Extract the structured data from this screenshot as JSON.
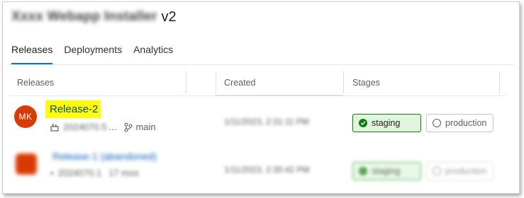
{
  "header": {
    "title_redacted": "Xxxx Webapp Installer",
    "title_version": "v2"
  },
  "tabs": [
    {
      "label": "Releases"
    },
    {
      "label": "Deployments"
    },
    {
      "label": "Analytics"
    }
  ],
  "table": {
    "columns": [
      "Releases",
      "Created",
      "Stages"
    ],
    "rows": [
      {
        "avatar_initials": "MK",
        "name": "Release-2",
        "build": "2024070.5",
        "branch": "main",
        "created": "1/11/2023, 2:31:11 PM",
        "stages": [
          {
            "label": "staging",
            "status": "succeeded"
          },
          {
            "label": "production",
            "status": "not-deployed"
          }
        ]
      },
      {
        "avatar_initials": "",
        "name": "Release-1 (abandoned)",
        "build": "2024070.1",
        "age": "17 mos",
        "created": "1/11/2023, 2:30:42 PM",
        "stages": [
          {
            "label": "staging",
            "status": "succeeded"
          },
          {
            "label": "production",
            "status": "not-deployed"
          }
        ]
      }
    ]
  },
  "colors": {
    "accent": "#0078d4",
    "avatar": "#d83b01",
    "success": "#107c10",
    "highlight": "#ffff00"
  }
}
